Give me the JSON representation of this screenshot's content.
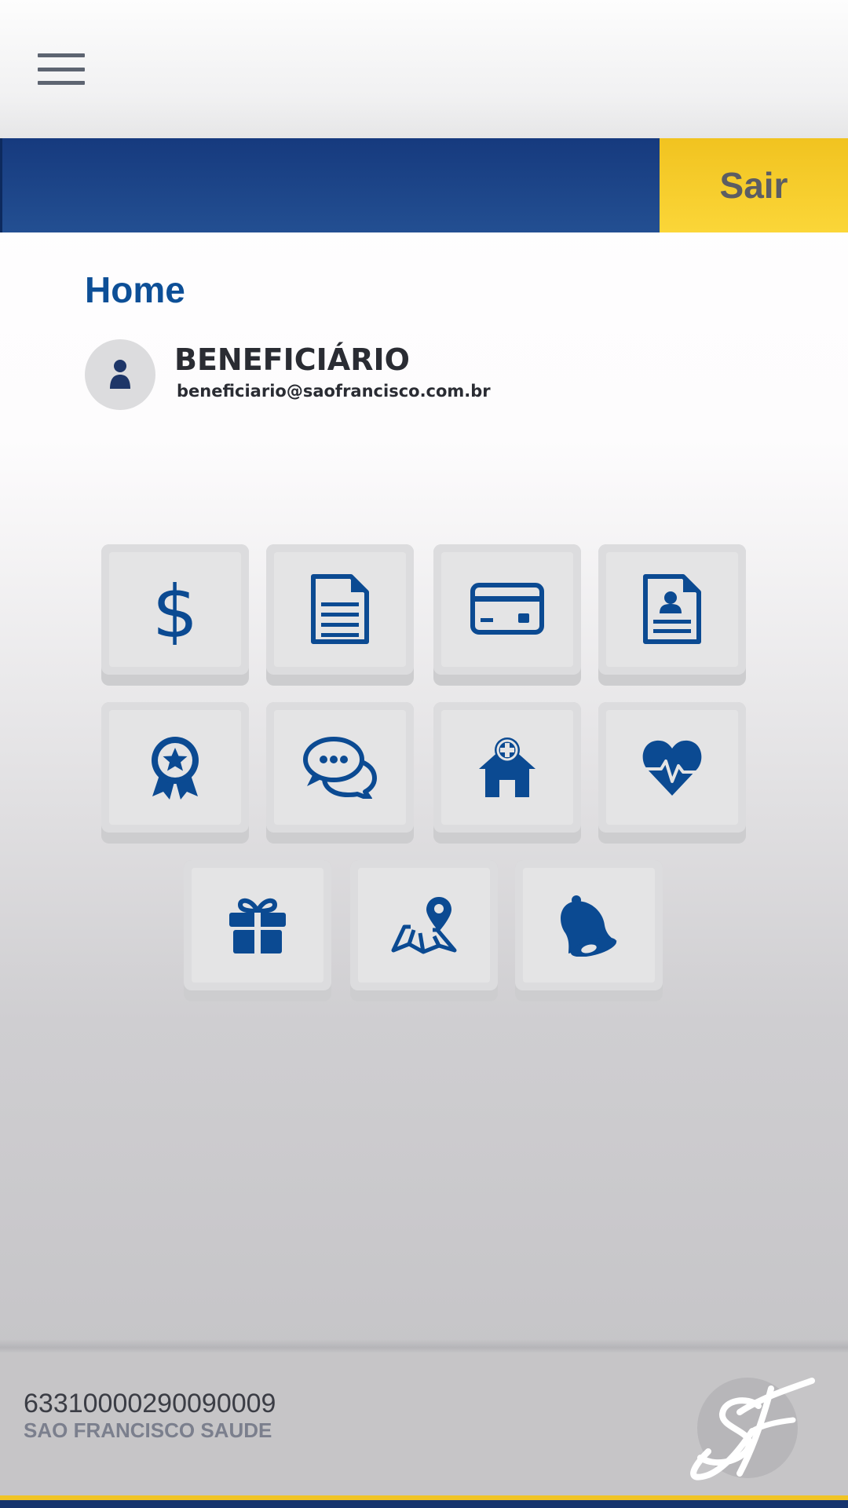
{
  "header": {
    "menu_icon": "hamburger-menu-icon",
    "logout_label": "Sair"
  },
  "colors": {
    "primary_blue": "#0d4f97",
    "header_blue": "#1d4589",
    "accent_yellow": "#f7cd2c",
    "icon_blue": "#0b4a92"
  },
  "page": {
    "title": "Home"
  },
  "user": {
    "avatar_icon": "user-icon",
    "name": "BENEFICIÁRIO",
    "email": "beneficiario@saofrancisco.com.br"
  },
  "menu_tiles": [
    {
      "icon": "dollar-icon"
    },
    {
      "icon": "document-icon"
    },
    {
      "icon": "credit-card-icon"
    },
    {
      "icon": "id-document-icon"
    },
    {
      "icon": "award-badge-icon"
    },
    {
      "icon": "chat-bubbles-icon"
    },
    {
      "icon": "health-home-icon"
    },
    {
      "icon": "heart-pulse-icon"
    },
    {
      "icon": "gift-icon"
    },
    {
      "icon": "map-pin-icon"
    },
    {
      "icon": "bell-icon"
    }
  ],
  "footer": {
    "card_number": "63310000290090009",
    "company": "SAO FRANCISCO SAUDE",
    "logo_icon": "sf-logo-icon"
  }
}
